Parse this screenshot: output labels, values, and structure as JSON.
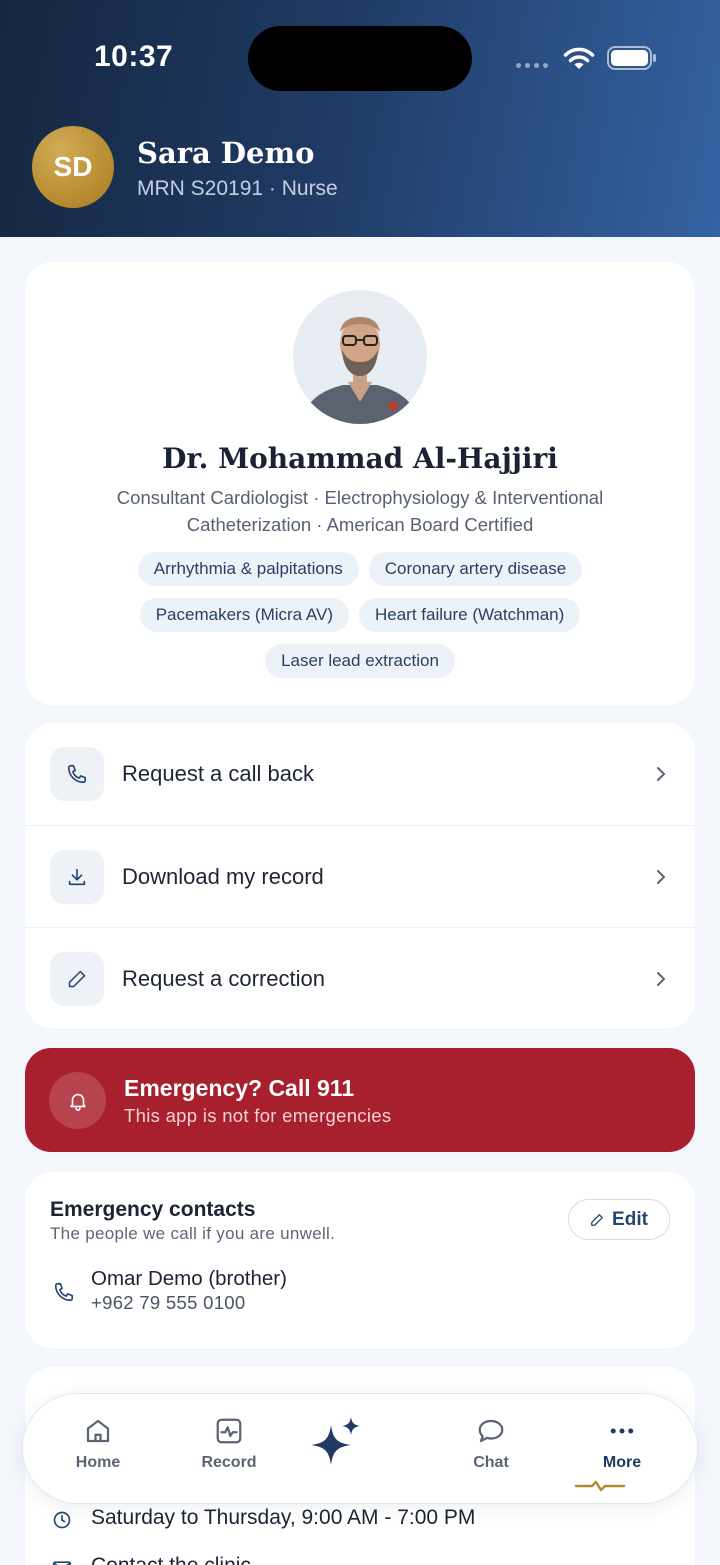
{
  "status_bar": {
    "time": "10:37"
  },
  "user": {
    "initials": "SD",
    "name": "Sara Demo",
    "subtitle": "MRN S20191 · Nurse"
  },
  "doctor": {
    "name": "Dr. Mohammad Al-Hajjiri",
    "title": "Consultant Cardiologist · Electrophysiology & Interventional Catheterization · American Board Certified",
    "specialties": [
      "Arrhythmia & palpitations",
      "Coronary artery disease",
      "Pacemakers (Micra AV)",
      "Heart failure (Watchman)",
      "Laser lead extraction"
    ]
  },
  "actions": [
    {
      "label": "Request a call back",
      "icon": "phone-icon"
    },
    {
      "label": "Download my record",
      "icon": "download-icon"
    },
    {
      "label": "Request a correction",
      "icon": "pencil-icon"
    }
  ],
  "emergency": {
    "title": "Emergency? Call 911",
    "subtitle": "This app is not for emergencies",
    "color": "#a81f2d"
  },
  "emergency_contacts": {
    "title": "Emergency contacts",
    "subtitle": "The people we call if you are unwell.",
    "edit_label": "Edit",
    "contact_name": "Omar Demo (brother)",
    "contact_phone": "+962 79 555 0100"
  },
  "clinic": {
    "hours": "Saturday to Thursday, 9:00 AM - 7:00 PM",
    "contact": "Contact the clinic"
  },
  "tabbar": {
    "tabs": [
      {
        "label": "Home",
        "icon": "home-icon"
      },
      {
        "label": "Record",
        "icon": "record-icon"
      },
      {
        "label": "",
        "icon": "sparkle-icon"
      },
      {
        "label": "Chat",
        "icon": "chat-icon"
      },
      {
        "label": "More",
        "icon": "more-icon"
      }
    ],
    "active": "More"
  },
  "colors": {
    "header_dark": "#152740",
    "header_light": "#3462a2",
    "accent_gold": "#b58a2e",
    "primary": "#1f3a63"
  }
}
